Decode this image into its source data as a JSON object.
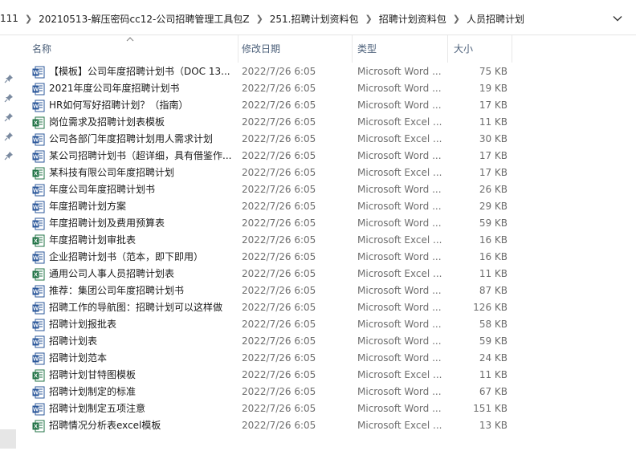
{
  "breadcrumb": [
    "111",
    "20210513-解压密码cc12-公司招聘管理工具包Z",
    "251.招聘计划资料包",
    "招聘计划资料包",
    "人员招聘计划"
  ],
  "columns": {
    "name": "名称",
    "date": "修改日期",
    "type": "类型",
    "size": "大小"
  },
  "colors": {
    "word": "#2b579a",
    "excel": "#217346",
    "header_text": "#4c607a",
    "detail_text": "#6d6d6d"
  },
  "files": [
    {
      "kind": "word",
      "icon": "word-doc-icon",
      "name": "【模板】公司年度招聘计划书（DOC 13...",
      "date": "2022/7/26 6:05",
      "type": "Microsoft Word ...",
      "size": "75 KB"
    },
    {
      "kind": "word",
      "icon": "word-doc-icon",
      "name": "2021年度公司年度招聘计划书",
      "date": "2022/7/26 6:05",
      "type": "Microsoft Word ...",
      "size": "19 KB"
    },
    {
      "kind": "word",
      "icon": "word-doc-icon",
      "name": "HR如何写好招聘计划？（指南）",
      "date": "2022/7/26 6:05",
      "type": "Microsoft Word ...",
      "size": "17 KB"
    },
    {
      "kind": "excel",
      "icon": "excel-sheet-icon",
      "name": "岗位需求及招聘计划表模板",
      "date": "2022/7/26 6:05",
      "type": "Microsoft Excel ...",
      "size": "11 KB"
    },
    {
      "kind": "word",
      "icon": "word-doc-icon",
      "name": "公司各部门年度招聘计划用人需求计划",
      "date": "2022/7/26 6:05",
      "type": "Microsoft Excel ...",
      "size": "30 KB"
    },
    {
      "kind": "word",
      "icon": "word-doc-icon",
      "name": "某公司招聘计划书（超详细，具有借鉴作...",
      "date": "2022/7/26 6:05",
      "type": "Microsoft Word ...",
      "size": "17 KB"
    },
    {
      "kind": "excel",
      "icon": "excel-sheet-icon",
      "name": "某科技有限公司年度招聘计划",
      "date": "2022/7/26 6:05",
      "type": "Microsoft Excel ...",
      "size": "17 KB"
    },
    {
      "kind": "word",
      "icon": "word-doc-icon",
      "name": "年度公司年度招聘计划书",
      "date": "2022/7/26 6:05",
      "type": "Microsoft Word ...",
      "size": "26 KB"
    },
    {
      "kind": "word",
      "icon": "word-doc-icon",
      "name": "年度招聘计划方案",
      "date": "2022/7/26 6:05",
      "type": "Microsoft Word ...",
      "size": "29 KB"
    },
    {
      "kind": "word",
      "icon": "word-doc-icon",
      "name": "年度招聘计划及费用预算表",
      "date": "2022/7/26 6:05",
      "type": "Microsoft Word ...",
      "size": "59 KB"
    },
    {
      "kind": "excel",
      "icon": "excel-sheet-icon",
      "name": "年度招聘计划审批表",
      "date": "2022/7/26 6:05",
      "type": "Microsoft Excel ...",
      "size": "16 KB"
    },
    {
      "kind": "word",
      "icon": "word-doc-icon",
      "name": "企业招聘计划书（范本，即下即用）",
      "date": "2022/7/26 6:05",
      "type": "Microsoft Word ...",
      "size": "16 KB"
    },
    {
      "kind": "excel",
      "icon": "excel-sheet-icon",
      "name": "通用公司人事人员招聘计划表",
      "date": "2022/7/26 6:05",
      "type": "Microsoft Excel ...",
      "size": "11 KB"
    },
    {
      "kind": "word",
      "icon": "word-doc-icon",
      "name": "推荐：集团公司年度招聘计划书",
      "date": "2022/7/26 6:05",
      "type": "Microsoft Word ...",
      "size": "87 KB"
    },
    {
      "kind": "word",
      "icon": "word-doc-icon",
      "name": "招聘工作的导航图：招聘计划可以这样做",
      "date": "2022/7/26 6:05",
      "type": "Microsoft Word ...",
      "size": "126 KB"
    },
    {
      "kind": "word",
      "icon": "word-doc-icon",
      "name": "招聘计划报批表",
      "date": "2022/7/26 6:05",
      "type": "Microsoft Word ...",
      "size": "58 KB"
    },
    {
      "kind": "word",
      "icon": "word-doc-icon",
      "name": "招聘计划表",
      "date": "2022/7/26 6:05",
      "type": "Microsoft Word ...",
      "size": "59 KB"
    },
    {
      "kind": "word",
      "icon": "word-doc-icon",
      "name": "招聘计划范本",
      "date": "2022/7/26 6:05",
      "type": "Microsoft Word ...",
      "size": "24 KB"
    },
    {
      "kind": "excel",
      "icon": "excel-sheet-icon",
      "name": "招聘计划甘特图模板",
      "date": "2022/7/26 6:05",
      "type": "Microsoft Excel ...",
      "size": "11 KB"
    },
    {
      "kind": "word",
      "icon": "word-doc-icon",
      "name": "招聘计划制定的标准",
      "date": "2022/7/26 6:05",
      "type": "Microsoft Word ...",
      "size": "67 KB"
    },
    {
      "kind": "word",
      "icon": "word-doc-icon",
      "name": "招聘计划制定五项注意",
      "date": "2022/7/26 6:05",
      "type": "Microsoft Word ...",
      "size": "151 KB"
    },
    {
      "kind": "excel",
      "icon": "excel-sheet-icon",
      "name": "招聘情况分析表excel模板",
      "date": "2022/7/26 6:05",
      "type": "Microsoft Excel ...",
      "size": "13 KB"
    }
  ]
}
